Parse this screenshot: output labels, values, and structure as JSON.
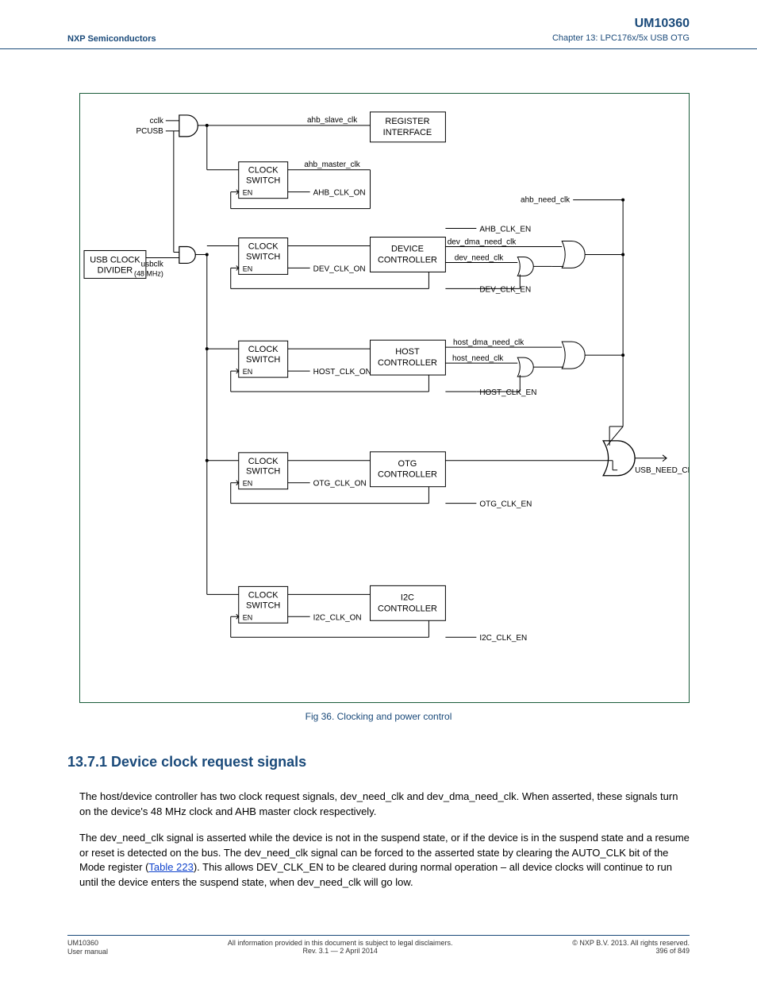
{
  "header": {
    "left": "NXP Semiconductors",
    "right_line1": "UM10360",
    "right_line2": "Chapter 13: LPC176x/5x USB OTG"
  },
  "figure": {
    "caption": "Fig 36.  Clocking and power control",
    "blocks": {
      "usb_clock_divider_l1": "USB CLOCK",
      "usb_clock_divider_l2": "DIVIDER",
      "register_interface_l1": "REGISTER",
      "register_interface_l2": "INTERFACE",
      "clock_switch_l1": "CLOCK",
      "clock_switch_l2": "SWITCH",
      "en": "EN",
      "device_controller_l1": "DEVICE",
      "device_controller_l2": "CONTROLLER",
      "host_controller_l1": "HOST",
      "host_controller_l2": "CONTROLLER",
      "otg_controller_l1": "OTG",
      "otg_controller_l2": "CONTROLLER",
      "i2c_controller_l1": "I2C",
      "i2c_controller_l2": "CONTROLLER"
    },
    "signals": {
      "cclk": "cclk",
      "pcusb": "PCUSB",
      "usbclk": "usbclk",
      "usbclk_freq": "(48 MHz)",
      "ahb_slave_clk": "ahb_slave_clk",
      "ahb_master_clk": "ahb_master_clk",
      "ahb_clk_on": "AHB_CLK_ON",
      "ahb_need_clk": "ahb_need_clk",
      "ahb_clk_en": "AHB_CLK_EN",
      "dev_dma_need_clk": "dev_dma_need_clk",
      "dev_need_clk": "dev_need_clk",
      "dev_clk_on": "DEV_CLK_ON",
      "dev_clk_en": "DEV_CLK_EN",
      "host_dma_need_clk": "host_dma_need_clk",
      "host_need_clk": "host_need_clk",
      "host_clk_on": "HOST_CLK_ON",
      "host_clk_en": "HOST_CLK_EN",
      "otg_clk_on": "OTG_CLK_ON",
      "otg_clk_en": "OTG_CLK_EN",
      "i2c_clk_on": "I2C_CLK_ON",
      "i2c_clk_en": "I2C_CLK_EN",
      "usb_need_clk": "USB_NEED_CLK"
    }
  },
  "body": {
    "section_title": "13.7.1 Device clock request signals",
    "p1": "The host/device controller has two clock request signals, dev_need_clk and dev_dma_need_clk. When asserted, these signals turn on the device's 48 MHz clock and AHB master clock respectively.",
    "p2a": "The dev_need_clk signal is asserted while the device is not in the suspend state, or if the device is in the suspend state and a resume or reset is detected on the bus. The dev_need_clk signal can be forced to the asserted state by clearing the AUTO_CLK bit of the Mode register (",
    "p2_link": "Table 223",
    "p2b": "). This allows DEV_CLK_EN to be cleared during normal operation – all device clocks will continue to run until the device enters the suspend state, when dev_need_clk will go low."
  },
  "footer": {
    "doc_id": "UM10360",
    "user_manual": "User manual",
    "rights": "All information provided in this document is subject to legal disclaimers.",
    "copyright": "© NXP B.V. 2013. All rights reserved.",
    "rev": "Rev. 3.1 — 2 April 2014",
    "page": "396 of 849"
  }
}
